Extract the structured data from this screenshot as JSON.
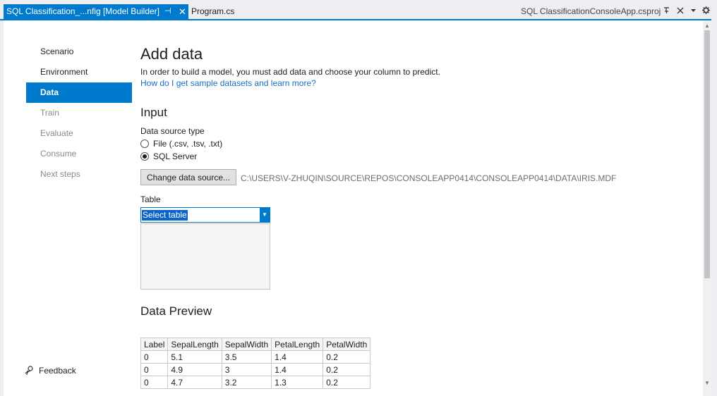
{
  "tabs": {
    "active_label": "SQL Classification_...nfig [Model Builder]",
    "pin_glyph": "⊣",
    "close_glyph": "✕",
    "inactive_label": "Program.cs",
    "project_title": "SQL ClassificationConsoleApp.csproj"
  },
  "nav": {
    "items": [
      {
        "label": "Scenario"
      },
      {
        "label": "Environment"
      },
      {
        "label": "Data"
      },
      {
        "label": "Train"
      },
      {
        "label": "Evaluate"
      },
      {
        "label": "Consume"
      },
      {
        "label": "Next steps"
      }
    ],
    "feedback_label": "Feedback"
  },
  "main": {
    "title": "Add data",
    "intro": "In order to build a model, you must add data and choose your column to predict.",
    "help_link": "How do I get sample datasets and learn more?",
    "input_heading": "Input",
    "source_type_label": "Data source type",
    "source_options": [
      {
        "label": "File (.csv, .tsv, .txt)",
        "checked": false
      },
      {
        "label": "SQL Server",
        "checked": true
      }
    ],
    "change_source_button": "Change data source...",
    "source_path": "C:\\USERS\\V-ZHUQIN\\SOURCE\\REPOS\\CONSOLEAPP0414\\CONSOLEAPP0414\\DATA\\IRIS.MDF",
    "table_label": "Table",
    "table_select_value": "Select table",
    "preview_heading": "Data Preview",
    "preview": {
      "columns": [
        "Label",
        "SepalLength",
        "SepalWidth",
        "PetalLength",
        "PetalWidth"
      ],
      "rows": [
        [
          "0",
          "5.1",
          "3.5",
          "1.4",
          "0.2"
        ],
        [
          "0",
          "4.9",
          "3",
          "1.4",
          "0.2"
        ],
        [
          "0",
          "4.7",
          "3.2",
          "1.3",
          "0.2"
        ]
      ]
    }
  },
  "colors": {
    "accent": "#007acc",
    "selection": "#0a64c8",
    "link": "#1a6fc4"
  }
}
